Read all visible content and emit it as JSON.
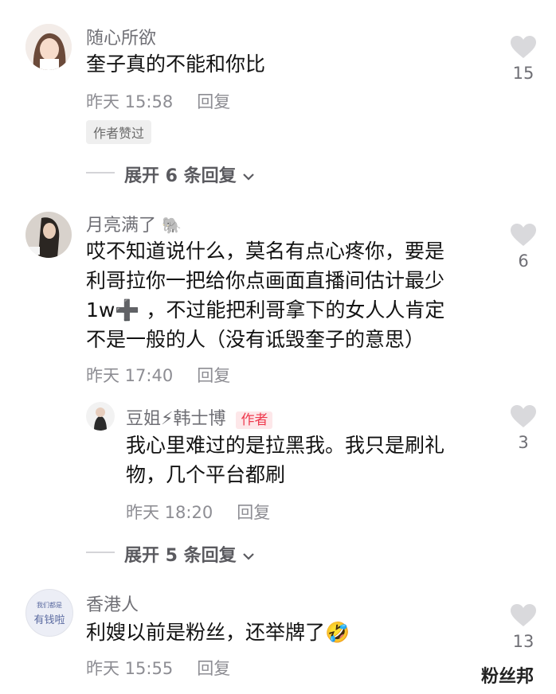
{
  "comments": [
    {
      "user": "随心所欲",
      "text": "奎子真的不能和你比",
      "time": "昨天 15:58",
      "reply": "回复",
      "badge": "作者赞过",
      "likes": "15",
      "expand": "展开 6 条回复"
    },
    {
      "user": "月亮满了",
      "user_emoji": "🐘",
      "lines": [
        "哎不知道说什么，莫名有点心疼你，要是",
        "利哥拉你一把给你点画面直播间估计最少",
        "1w➕ ，不过能把利哥拿下的女人人肯定",
        "不是一般的人（没有诋毁奎子的意思）"
      ],
      "time": "昨天 17:40",
      "reply": "回复",
      "likes": "6",
      "sub_reply": {
        "user": "豆姐⚡韩士博",
        "author_badge": "作者",
        "lines": [
          "我心里难过的是拉黑我。我只是刷礼",
          "物，几个平台都刷"
        ],
        "time": "昨天 18:20",
        "reply": "回复",
        "likes": "3"
      },
      "expand": "展开 5 条回复"
    },
    {
      "user": "香港人",
      "avatar_text": [
        "我们都是",
        "有钱啦"
      ],
      "text": "利嫂以前是粉丝，还举牌了🤣",
      "time": "昨天 15:55",
      "reply": "回复",
      "likes": "13"
    }
  ],
  "watermark": "粉丝邦",
  "colors": {
    "author_badge_bg": "#fde7e9",
    "author_badge_text": "#ee3a4e",
    "like_heart": "#d9d9dc",
    "lightning": "#f5c518"
  }
}
